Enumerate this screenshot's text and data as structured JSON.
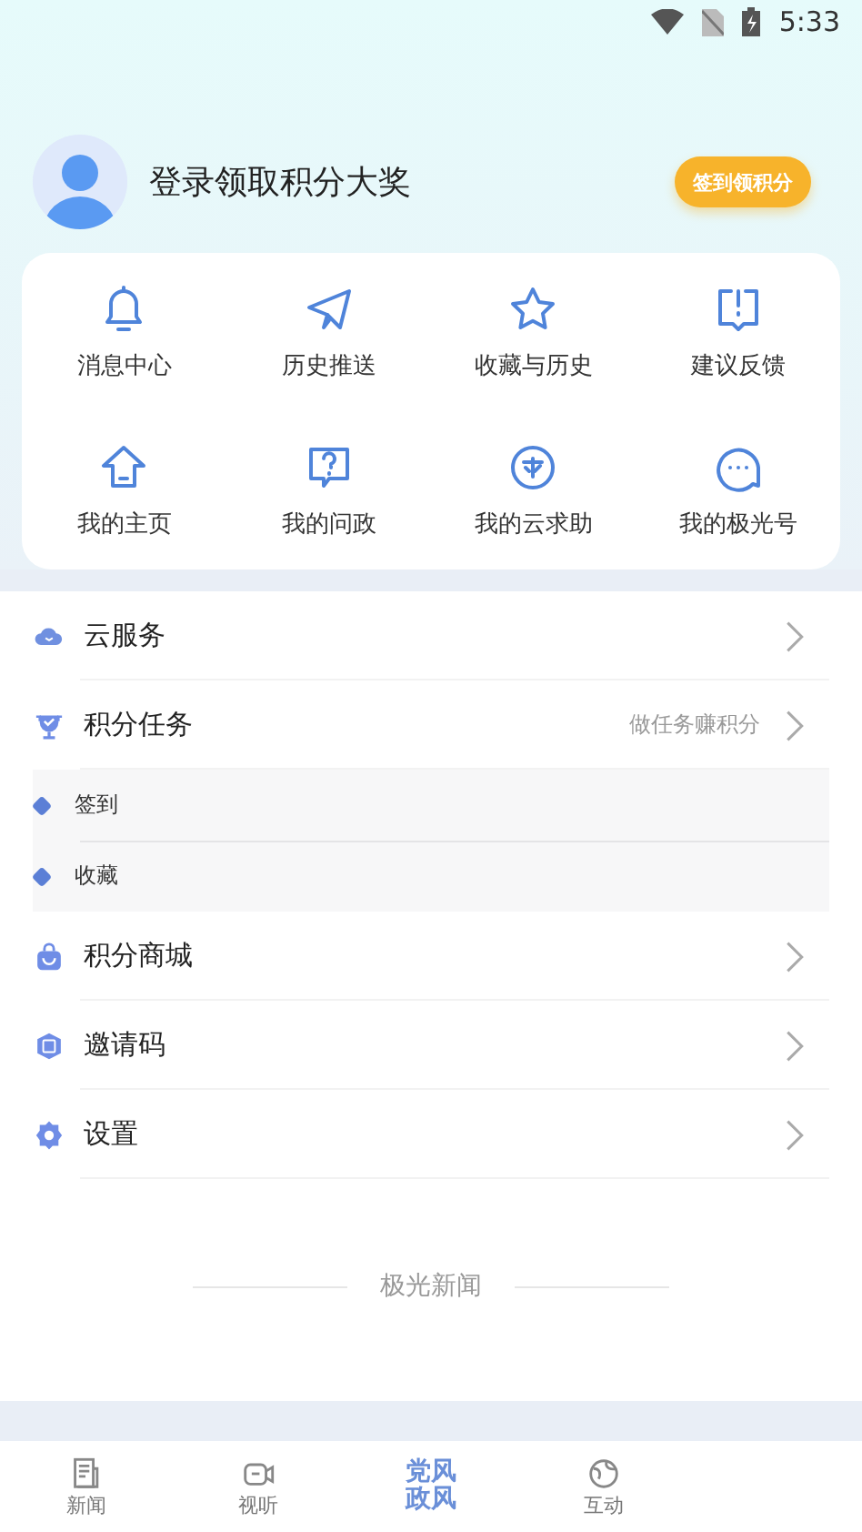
{
  "status_bar": {
    "time": "5:33"
  },
  "profile": {
    "prompt": "登录领取积分大奖",
    "sign_in_button": "签到领积分"
  },
  "shortcuts": [
    {
      "label": "消息中心"
    },
    {
      "label": "历史推送"
    },
    {
      "label": "收藏与历史"
    },
    {
      "label": "建议反馈"
    },
    {
      "label": "我的主页"
    },
    {
      "label": "我的问政"
    },
    {
      "label": "我的云求助"
    },
    {
      "label": "我的极光号"
    }
  ],
  "menu": [
    {
      "kind": "row",
      "label": "云服务"
    },
    {
      "kind": "row",
      "label": "积分任务",
      "hint": "做任务赚积分"
    },
    {
      "kind": "sub",
      "label": "签到"
    },
    {
      "kind": "sub",
      "label": "收藏"
    },
    {
      "kind": "row",
      "label": "积分商城"
    },
    {
      "kind": "row",
      "label": "邀请码"
    },
    {
      "kind": "row",
      "label": "设置"
    }
  ],
  "footer": "极光新闻",
  "tabs": [
    {
      "label": "新闻",
      "kind": "icon",
      "selected": false
    },
    {
      "label": "视听",
      "kind": "icon",
      "selected": false
    },
    {
      "label": "党风政风",
      "kind": "logo",
      "selected": true
    },
    {
      "label": "互动",
      "kind": "icon",
      "selected": false
    }
  ]
}
